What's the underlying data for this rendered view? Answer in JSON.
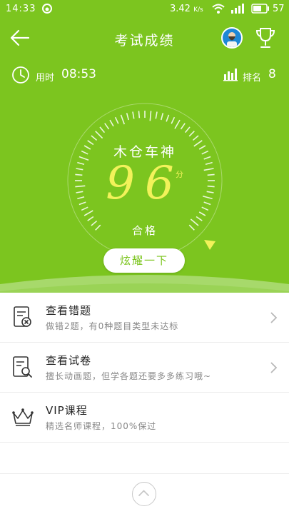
{
  "status_bar": {
    "time": "14:33",
    "speed": "3.42",
    "speed_unit": "K/s",
    "battery": "57",
    "icons": [
      "app-icon",
      "wifi-icon",
      "signal-icon",
      "battery-icon"
    ]
  },
  "nav": {
    "title": "考试成绩",
    "icons": [
      "back-arrow-icon",
      "avatar",
      "trophy-icon"
    ]
  },
  "stats": {
    "time_label": "用时",
    "time_value": "08:53",
    "rank_label": "排名",
    "rank_value": "8"
  },
  "result": {
    "nickname": "木仓车神",
    "score": "96",
    "score_unit": "分",
    "grade": "合格"
  },
  "share_button": "炫耀一下",
  "menu": [
    {
      "icon": "wrong-questions-icon",
      "title": "查看错题",
      "subtitle": "做错2题，有0种题目类型未达标"
    },
    {
      "icon": "review-paper-icon",
      "title": "查看试卷",
      "subtitle": "擅长动画题，但学各题还要多多练习哦~"
    },
    {
      "icon": "crown-icon",
      "title": "VIP课程",
      "subtitle": "精选名师课程，100%保过"
    }
  ],
  "colors": {
    "header_green": "#7cc51f",
    "score_yellow": "#f2f25a"
  }
}
